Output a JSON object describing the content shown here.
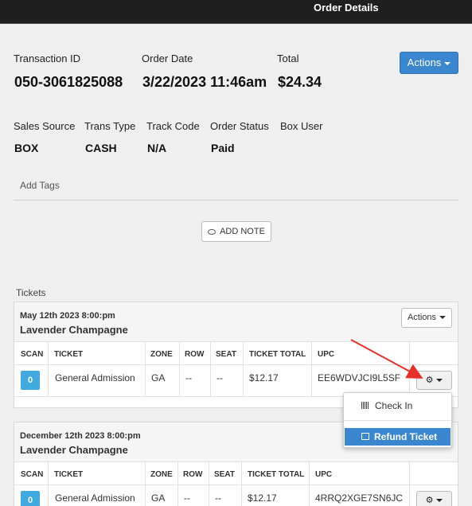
{
  "header": {
    "title": "Order Details"
  },
  "order": {
    "transaction_label": "Transaction ID",
    "transaction_value": "050-3061825088",
    "date_label": "Order Date",
    "date_value": "3/22/2023 11:46am",
    "total_label": "Total",
    "total_value": "$24.34",
    "actions_label": "Actions",
    "sales_source_label": "Sales Source",
    "sales_source_value": "BOX",
    "trans_type_label": "Trans Type",
    "trans_type_value": "CASH",
    "track_code_label": "Track Code",
    "track_code_value": "N/A",
    "order_status_label": "Order Status",
    "order_status_value": "Paid",
    "box_user_label": "Box User",
    "add_tags_label": "Add Tags",
    "add_note_label": "ADD NOTE"
  },
  "tickets_section": {
    "title": "Tickets",
    "columns": [
      "SCAN",
      "TICKET",
      "ZONE",
      "ROW",
      "SEAT",
      "TICKET TOTAL",
      "UPC"
    ],
    "cards": [
      {
        "date": "May 12th 2023 8:00:pm",
        "name": "Lavender Champagne",
        "actions_label": "Actions",
        "row": {
          "scan": "0",
          "ticket": "General Admission",
          "zone": "GA",
          "row": "--",
          "seat": "--",
          "total": "$12.17",
          "upc": "EE6WDVJCI9L5SF"
        }
      },
      {
        "date": "December 12th 2023 8:00:pm",
        "name": "Lavender Champagne",
        "row": {
          "scan": "0",
          "ticket": "General Admission",
          "zone": "GA",
          "row": "--",
          "seat": "--",
          "total": "$12.17",
          "upc": "4RRQ2XGE7SN6JC"
        }
      }
    ]
  },
  "dropdown_menu": {
    "items": [
      {
        "label": "Check In",
        "icon": "barcode-icon"
      },
      {
        "label": "Refund Ticket",
        "icon": "sign-out-icon"
      }
    ]
  },
  "colors": {
    "primary": "#3a87cf",
    "scan_badge": "#3fa9e0",
    "topbar": "#1f1f1f",
    "arrow": "#e8302a"
  }
}
